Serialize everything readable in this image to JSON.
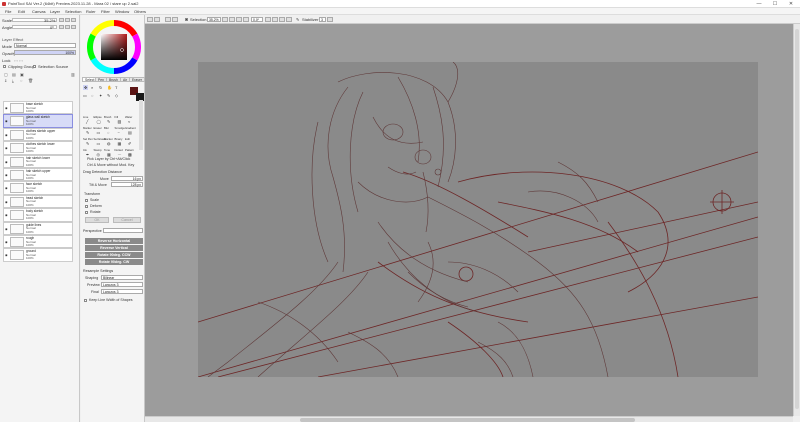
{
  "window": {
    "title": "PaintTool SAI Ver.2 (64bit) Preview.2023.11.28 - Mara 02 / stare up 2.sai2",
    "minimize": "—",
    "maximize": "☐",
    "close": "✕"
  },
  "menu": [
    "File",
    "Edit",
    "Canvas",
    "Layer",
    "Selection",
    "Ruler",
    "Filter",
    "Window",
    "Others"
  ],
  "left": {
    "size_label": "Scale",
    "size_value": "35.2%",
    "angle_label": "Angle",
    "angle_value": "0º",
    "layer_effect": "Layer Effect",
    "mode_label": "Mode",
    "mode_value": "Normal",
    "opacity_label": "Opacity",
    "opacity_value": "100%",
    "lock_label": "Lock",
    "clip_label": "Clipping Group",
    "selsrc_label": "Selection Source"
  },
  "layers": [
    {
      "name": "base sketch",
      "mode": "Normal",
      "opacity": "100%"
    },
    {
      "name": "glass wall sketch",
      "mode": "Normal",
      "opacity": "100%",
      "selected": true
    },
    {
      "name": "clothes sketch upper",
      "mode": "Normal",
      "opacity": "100%"
    },
    {
      "name": "clothes sketch lower",
      "mode": "Normal",
      "opacity": "100%"
    },
    {
      "name": "hair sketch lower",
      "mode": "Normal",
      "opacity": "100%"
    },
    {
      "name": "hair sketch upper",
      "mode": "Normal",
      "opacity": "100%"
    },
    {
      "name": "face sketch",
      "mode": "Normal",
      "opacity": "100%"
    },
    {
      "name": "head sketch",
      "mode": "Normal",
      "opacity": "100%"
    },
    {
      "name": "body sketch",
      "mode": "Normal",
      "opacity": "100%"
    },
    {
      "name": "guide lines",
      "mode": "Normal",
      "opacity": "100%"
    },
    {
      "name": "rough",
      "mode": "Normal",
      "opacity": "100%"
    },
    {
      "name": "ground",
      "mode": "Normal",
      "opacity": "100%"
    }
  ],
  "mid": {
    "tabs": [
      "Select",
      "Pen",
      "Brush",
      "Air",
      "Eraser"
    ],
    "tools": [
      {
        "label": "Line",
        "icon": "╱"
      },
      {
        "label": "Ellipse",
        "icon": "◯"
      },
      {
        "label": "Brush",
        "icon": "✎"
      },
      {
        "label": "Fill",
        "icon": "▨"
      },
      {
        "label": "Water",
        "icon": "≈"
      },
      {
        "label": "Marker",
        "icon": "✎"
      },
      {
        "label": "Eraser",
        "icon": "▭"
      },
      {
        "label": "Blur",
        "icon": "◌"
      },
      {
        "label": "Smudge",
        "icon": "~"
      },
      {
        "label": "Gradient",
        "icon": "▤"
      },
      {
        "label": "Sel Pen",
        "icon": "✎"
      },
      {
        "label": "Sel Eraser",
        "icon": "▭"
      },
      {
        "label": "Bucket",
        "icon": "◍"
      },
      {
        "label": "Binary",
        "icon": "▦"
      },
      {
        "label": "Edit",
        "icon": "✐"
      },
      {
        "label": "Ink",
        "icon": "✒"
      },
      {
        "label": "Stamp",
        "icon": "◎"
      },
      {
        "label": "Tone",
        "icon": "▦"
      },
      {
        "label": "Dotted",
        "icon": "⋯"
      },
      {
        "label": "Pattern",
        "icon": "▩"
      }
    ],
    "pick_layer": "Pick Layer by Ctrl+Alt/Click",
    "ctrl_move": "Ctrl & Move without Mod. Key",
    "drag_label": "Drag Detection Distance",
    "move_label": "Move",
    "move_value": "16 px",
    "tilt_label": "Tilt & Move",
    "tilt_value": "128 px",
    "transform_label": "Transform",
    "opt_scale": "Scale",
    "opt_deform": "Deform",
    "opt_rotate": "Rotate",
    "ok": "OK",
    "cancel": "Cancel",
    "perspective_label": "Perspective",
    "btn_rev_h": "Reverse Horizontal",
    "btn_rev_v": "Reverse Vertical",
    "btn_rot_ccw": "Rotate 90deg. CCW",
    "btn_rot_cw": "Rotate 90deg. CW",
    "resample_label": "Resample Settings",
    "shaping_label": "Shaping",
    "shaping_value": "Bilinear",
    "preview_label": "Preview",
    "preview_value": "Lanczos 3",
    "final_label": "Final",
    "final_value": "Lanczos 3",
    "keep_lines": "Keep Line Width of Shapes"
  },
  "toolbar": {
    "selection_label": "Selection",
    "zoom": "35.2%",
    "angle": "0.0º",
    "stabilizer_label": "Stabilizer",
    "stabilizer_value": "3"
  },
  "colors": {
    "fg": "#5b1515",
    "bg": "#1a1a1a",
    "sketch": "#6a1c1c",
    "panel": "#f4f4f4",
    "canvasbg": "#9c9c9c",
    "sheet": "#8a8a8a"
  }
}
